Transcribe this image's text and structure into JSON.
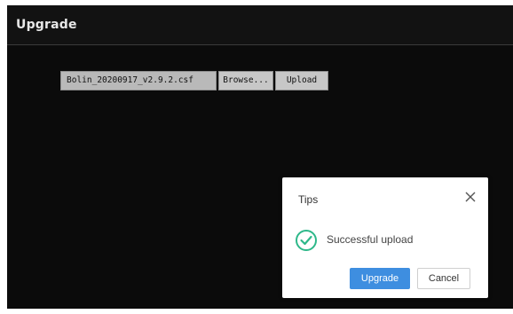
{
  "header": {
    "title": "Upgrade"
  },
  "upload_form": {
    "file_name": "Bolin_20200917_v2.9.2.csf",
    "browse_label": "Browse...",
    "upload_label": "Upload"
  },
  "dialog": {
    "title": "Tips",
    "close_icon": "close-icon",
    "status_icon": "check-circle-icon",
    "message": "Successful upload",
    "confirm_label": "Upgrade",
    "cancel_label": "Cancel"
  },
  "colors": {
    "screen_bg": "#0b0b0b",
    "primary_button": "#3e8ee0",
    "success_icon": "#2eb88a"
  }
}
